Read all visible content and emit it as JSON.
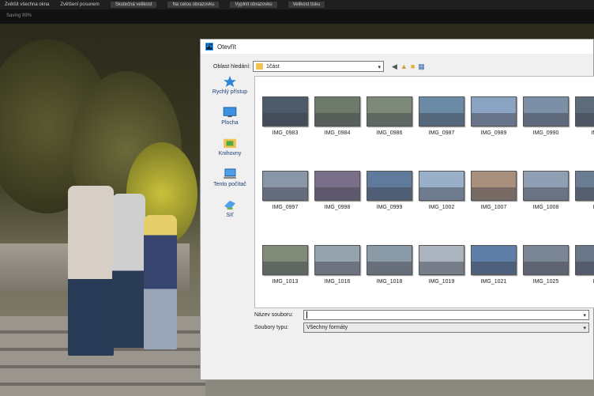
{
  "toolbar": {
    "items": [
      "Zvětšit všechna okna",
      "Zvětšení posunem",
      "Skutečná velikost",
      "Na celou obrazovku",
      "Vyplnit obrazovku",
      "Velikost tisku"
    ],
    "status": "Saving 99%"
  },
  "dialog": {
    "title": "Otevřít",
    "look_in_label": "Oblast hledání:",
    "look_in_value": "1část",
    "sidebar": [
      {
        "label": "Rychlý přístup",
        "icon": "star-icon"
      },
      {
        "label": "Plocha",
        "icon": "desktop-icon"
      },
      {
        "label": "Knihovny",
        "icon": "libraries-icon"
      },
      {
        "label": "Tento počítač",
        "icon": "computer-icon"
      },
      {
        "label": "Síť",
        "icon": "network-icon"
      }
    ],
    "files": [
      {
        "name": "IMG_0983",
        "color": "#4c5a6a"
      },
      {
        "name": "IMG_0984",
        "color": "#6d7a6a"
      },
      {
        "name": "IMG_0986",
        "color": "#7d8a7a"
      },
      {
        "name": "IMG_0987",
        "color": "#6a8aa5"
      },
      {
        "name": "IMG_0989",
        "color": "#8aa3c2"
      },
      {
        "name": "IMG_0990",
        "color": "#7b8fa6"
      },
      {
        "name": "IMG_",
        "color": "#5d6b7a"
      },
      {
        "name": "IMG_0997",
        "color": "#8896a8"
      },
      {
        "name": "IMG_0998",
        "color": "#7a6f8a"
      },
      {
        "name": "IMG_0999",
        "color": "#5f7a9a"
      },
      {
        "name": "IMG_1002",
        "color": "#9ab0c8"
      },
      {
        "name": "IMG_1007",
        "color": "#a8907d"
      },
      {
        "name": "IMG_1008",
        "color": "#8fa0b5"
      },
      {
        "name": "IMG",
        "color": "#6b7d92"
      },
      {
        "name": "IMG_1013",
        "color": "#7f8a78"
      },
      {
        "name": "IMG_1016",
        "color": "#95a3ad"
      },
      {
        "name": "IMG_1018",
        "color": "#8a9aa6"
      },
      {
        "name": "IMG_1019",
        "color": "#aab5c0"
      },
      {
        "name": "IMG_1021",
        "color": "#5e7ea8"
      },
      {
        "name": "IMG_1025",
        "color": "#7a8596"
      },
      {
        "name": "IMG",
        "color": "#687688"
      }
    ],
    "filename_label": "Název souboru:",
    "filename_value": "",
    "filetype_label": "Soubory typu:",
    "filetype_value": "Všechny formáty"
  }
}
